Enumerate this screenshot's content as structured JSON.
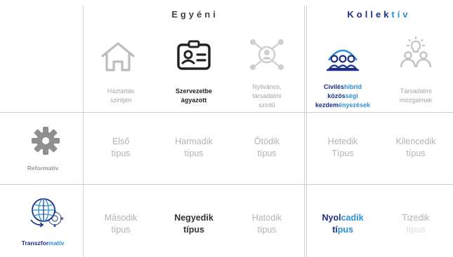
{
  "groups": {
    "egyeni": "Egyéni",
    "kollektiv_main": "Kollek",
    "kollektiv_accent": "tív"
  },
  "columns": [
    {
      "label_line1": "Háztartás",
      "label_line2": "szintjén",
      "label_line3": "",
      "icon": "house-icon"
    },
    {
      "label_line1": "Szervezetbe",
      "label_line2": "ágyazott",
      "label_line3": "",
      "icon": "id-badge-icon"
    },
    {
      "label_line1": "Nyilvános,",
      "label_line2": "társadalmi",
      "label_line3": "szintű",
      "icon": "network-person-icon"
    },
    {
      "label_line1_a": "Civilés",
      "label_line1_b": "hibrid",
      "label_line2_a": "közös",
      "label_line2_b": "ségi",
      "label_line3_a": "kezdem",
      "label_line3_b": "ényezések",
      "icon": "community-group-icon"
    },
    {
      "label_line1": "Társadalmi",
      "label_line2": "mozgalmak",
      "label_line3": "",
      "icon": "idea-people-icon"
    }
  ],
  "rows": [
    {
      "label": "Reformatív",
      "icon": "gear-icon"
    },
    {
      "label_a": "Transzfor",
      "label_b": "matív",
      "icon": "globe-gear-icon"
    }
  ],
  "cells": {
    "r1": [
      {
        "line1": "Első",
        "line2": "típus"
      },
      {
        "line1": "Harmadik",
        "line2": "típus"
      },
      {
        "line1": "Ötödik",
        "line2": "típus"
      },
      {
        "line1": "Hetedik",
        "line2": "Típus"
      },
      {
        "line1": "Kilencedik",
        "line2": "típus"
      }
    ],
    "r2": [
      {
        "line1": "Második",
        "line2": "típus"
      },
      {
        "line1": "Negyedik",
        "line2": "típus"
      },
      {
        "line1": "Hatodik",
        "line2": "típus"
      },
      {
        "line1_a": "Nyol",
        "line1_b": "cadik",
        "line2_a": "tí",
        "line2_b": "pus"
      },
      {
        "line1": "Tizedik",
        "line2": "típus"
      }
    ]
  },
  "colors": {
    "navy": "#1a2f86",
    "accent_blue": "#2a8fd4",
    "gray": "#b3b3b3",
    "dark": "#333333"
  }
}
